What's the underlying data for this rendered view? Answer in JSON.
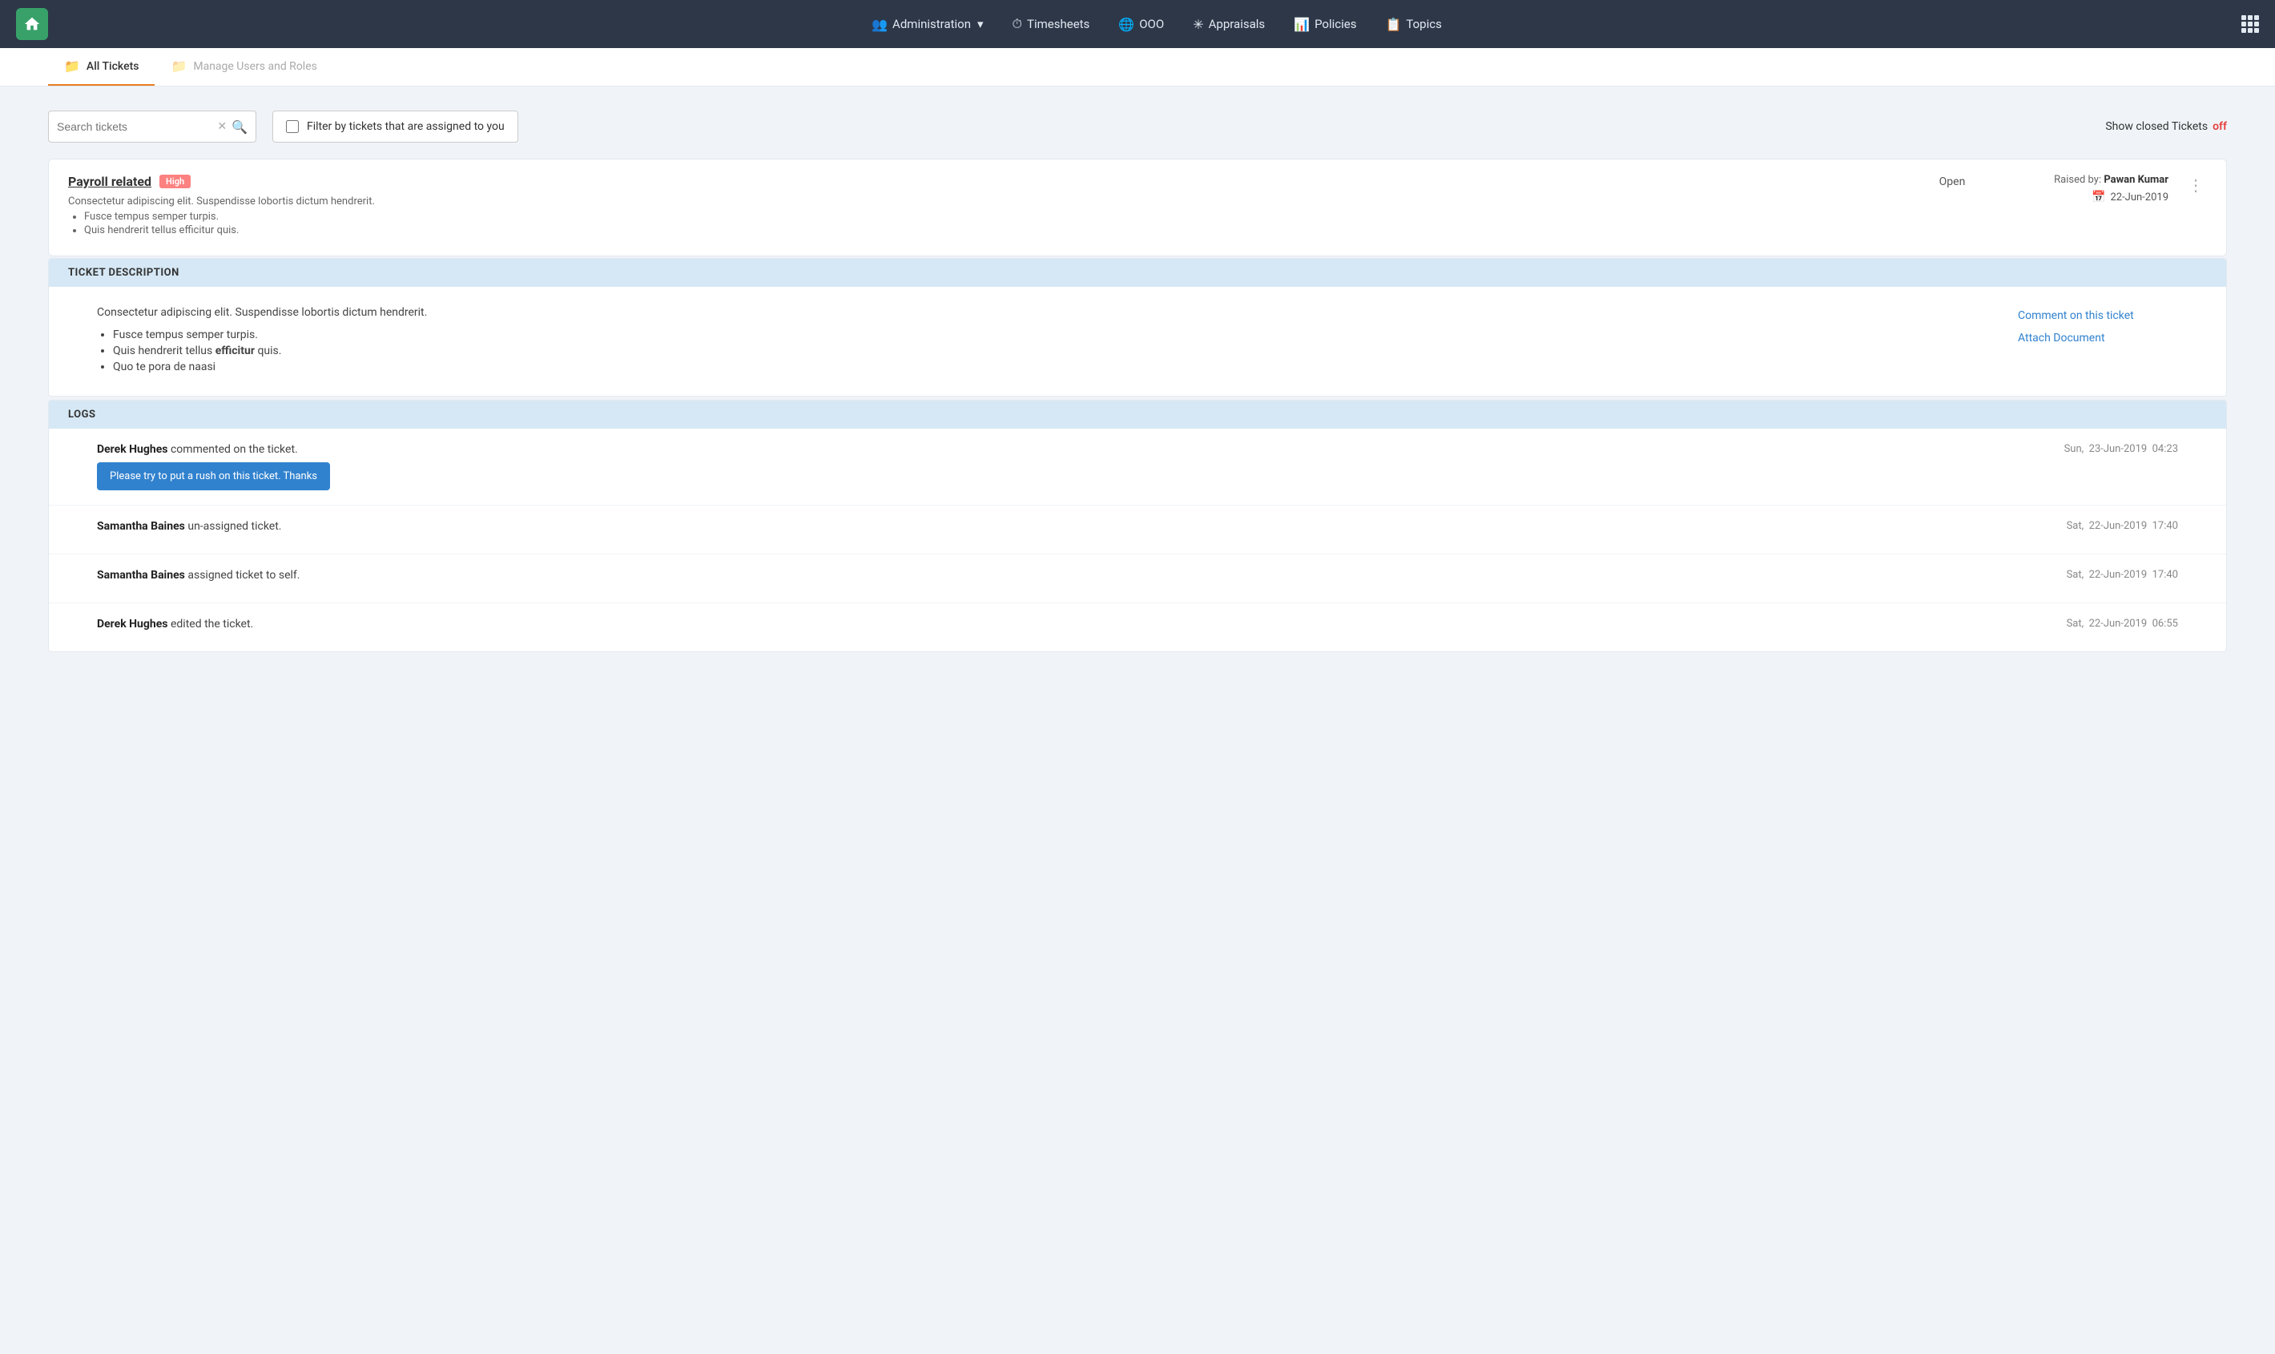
{
  "navbar": {
    "brand_icon": "🏠",
    "items": [
      {
        "id": "administration",
        "label": "Administration",
        "icon": "👥",
        "has_dropdown": true
      },
      {
        "id": "timesheets",
        "label": "Timesheets",
        "icon": "⏱"
      },
      {
        "id": "ooo",
        "label": "OOO",
        "icon": "🌐"
      },
      {
        "id": "appraisals",
        "label": "Appraisals",
        "icon": "✳"
      },
      {
        "id": "policies",
        "label": "Policies",
        "icon": "📊"
      },
      {
        "id": "topics",
        "label": "Topics",
        "icon": "📋"
      }
    ]
  },
  "subnav": {
    "tabs": [
      {
        "id": "all-tickets",
        "label": "All Tickets",
        "icon": "📁",
        "active": true
      },
      {
        "id": "manage-users",
        "label": "Manage Users and Roles",
        "icon": "📁",
        "active": false
      }
    ]
  },
  "filters": {
    "search_placeholder": "Search tickets",
    "filter_assigned_label": "Filter by tickets that are assigned to you",
    "show_closed_label": "Show closed Tickets",
    "show_closed_state": "off"
  },
  "ticket": {
    "title": "Payroll related",
    "priority": "High",
    "description_short": "Consectetur adipiscing elit. Suspendisse lobortis dictum hendrerit.",
    "bullet1": "Fusce tempus semper turpis.",
    "bullet2": "Quis hendrerit tellus efficitur quis.",
    "status": "Open",
    "raised_by_label": "Raised by:",
    "raised_by_name": "Pawan Kumar",
    "date": "22-Jun-2019"
  },
  "ticket_description": {
    "section_label": "TICKET DESCRIPTION",
    "body_text": "Consectetur adipiscing elit. Suspendisse lobortis dictum hendrerit.",
    "bullet1": "Fusce tempus semper turpis.",
    "bullet2_prefix": "Quis hendrerit tellus ",
    "bullet2_bold": "efficitur",
    "bullet2_suffix": " quis.",
    "bullet3": "Quo te pora de naasi",
    "action_comment": "Comment on this ticket",
    "action_attach": "Attach Document"
  },
  "logs": {
    "section_label": "LOGS",
    "entries": [
      {
        "id": "log1",
        "author": "Derek Hughes",
        "action": " commented on the ticket.",
        "comment": "Please try to put a rush on this ticket. Thanks",
        "has_comment": true,
        "day": "Sun",
        "date": "23-Jun-2019",
        "time": "04:23"
      },
      {
        "id": "log2",
        "author": "Samantha Baines",
        "action": " un-assigned ticket.",
        "has_comment": false,
        "day": "Sat",
        "date": "22-Jun-2019",
        "time": "17:40"
      },
      {
        "id": "log3",
        "author": "Samantha Baines",
        "action": " assigned ticket to self.",
        "has_comment": false,
        "day": "Sat",
        "date": "22-Jun-2019",
        "time": "17:40"
      },
      {
        "id": "log4",
        "author": "Derek Hughes",
        "action": " edited the ticket.",
        "has_comment": false,
        "day": "Sat",
        "date": "22-Jun-2019",
        "time": "06:55"
      }
    ]
  }
}
